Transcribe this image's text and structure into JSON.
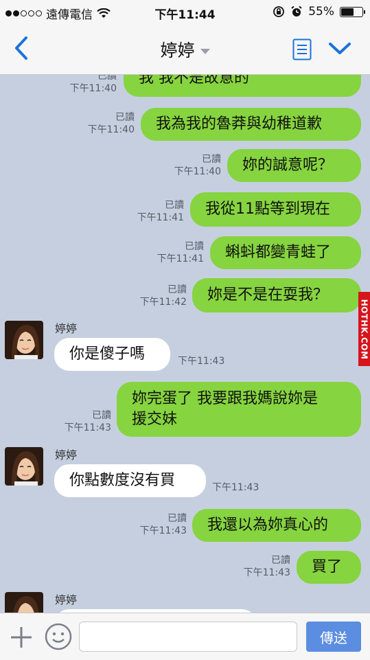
{
  "status_bar": {
    "carrier": "遠傳電信",
    "time": "下午11:44",
    "battery": "55%",
    "battery_level": 0.55
  },
  "header": {
    "title": "婷婷"
  },
  "messages": [
    {
      "dir": "out",
      "read": "已讀",
      "time": "下午11:40",
      "text": "我 我不是故意的"
    },
    {
      "dir": "out",
      "read": "已讀",
      "time": "下午11:40",
      "text": "我為我的魯莽與幼稚道歉"
    },
    {
      "dir": "out",
      "read": "已讀",
      "time": "下午11:40",
      "text": "妳的誠意呢？"
    },
    {
      "dir": "out",
      "read": "已讀",
      "time": "下午11:41",
      "text": "我從11點等到現在"
    },
    {
      "dir": "out",
      "read": "已讀",
      "time": "下午11:41",
      "text": "蝌蚪都變青蛙了"
    },
    {
      "dir": "out",
      "read": "已讀",
      "time": "下午11:42",
      "text": "妳是不是在耍我？"
    },
    {
      "dir": "in",
      "sender": "婷婷",
      "time": "下午11:43",
      "text": "你是傻子嗎"
    },
    {
      "dir": "out",
      "read": "已讀",
      "time": "下午11:43",
      "text": "妳完蛋了 我要跟我媽說妳是援交妹",
      "lines": [
        "妳完蛋了 我要跟我媽說妳是",
        "援交妹"
      ]
    },
    {
      "dir": "in",
      "sender": "婷婷",
      "time": "下午11:43",
      "text": "你點數度沒有買"
    },
    {
      "dir": "out",
      "read": "已讀",
      "time": "下午11:43",
      "text": "我還以為妳真心的"
    },
    {
      "dir": "out",
      "read": "已讀",
      "time": "下午11:43",
      "text": "買了"
    },
    {
      "dir": "in",
      "sender": "婷婷",
      "time": "",
      "text": ""
    }
  ],
  "input_bar": {
    "send_label": "傳送",
    "placeholder": ""
  },
  "watermark": "HOTHK.COM",
  "colors": {
    "outgoing_bubble": "#86d43f",
    "incoming_bubble": "#ffffff",
    "chat_background": "#c6cfdf",
    "accent": "#1a74d6",
    "send_button": "#5b8de0"
  }
}
